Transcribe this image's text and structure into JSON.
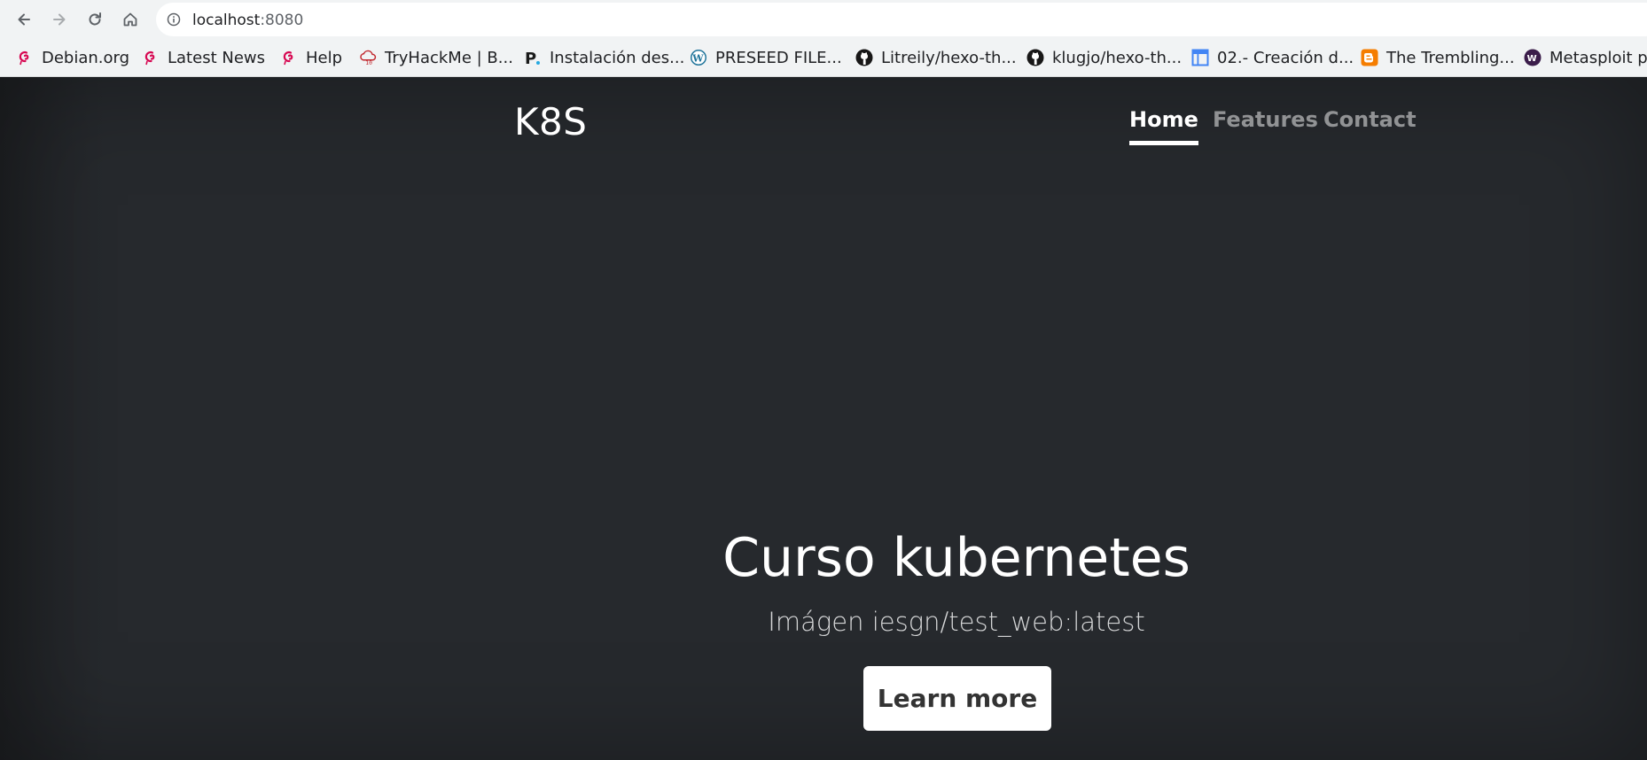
{
  "browser": {
    "url_host": "localhost",
    "url_port": ":8080",
    "bookmarks": [
      {
        "label": "Debian.org",
        "icon": "debian-swirl-icon"
      },
      {
        "label": "Latest News",
        "icon": "debian-swirl-icon"
      },
      {
        "label": "Help",
        "icon": "debian-swirl-icon"
      },
      {
        "label": "TryHackMe | B...",
        "icon": "tryhackme-cloud-icon"
      },
      {
        "label": "Instalación des...",
        "icon": "p-letter-icon"
      },
      {
        "label": "PRESEED FILE...",
        "icon": "wordpress-icon"
      },
      {
        "label": "Litreily/hexo-th...",
        "icon": "github-icon"
      },
      {
        "label": "klugjo/hexo-th...",
        "icon": "github-icon"
      },
      {
        "label": "02.- Creación d...",
        "icon": "google-sites-icon"
      },
      {
        "label": "The Trembling...",
        "icon": "blogger-icon"
      },
      {
        "label": "Metasploit pa",
        "icon": "metasploit-icon"
      }
    ]
  },
  "site": {
    "brand": "K8S",
    "nav": [
      {
        "label": "Home",
        "active": true
      },
      {
        "label": "Features",
        "active": false
      },
      {
        "label": "Contact",
        "active": false
      }
    ],
    "hero": {
      "title": "Curso kubernetes",
      "subtitle": "Imágen iesgn/test_web:latest",
      "cta_label": "Learn more"
    }
  },
  "colors": {
    "page_background": "#25282c",
    "chrome_background": "#f1f3f4",
    "debian_red": "#d70751",
    "github_black": "#181717",
    "blogger_orange": "#f57d00"
  }
}
